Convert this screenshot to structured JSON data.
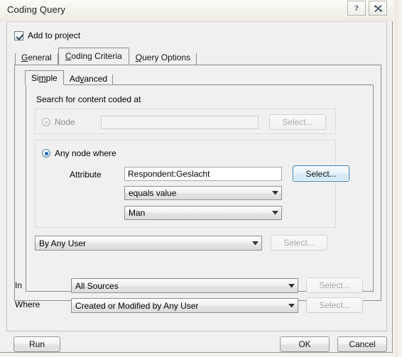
{
  "window": {
    "title": "Coding Query",
    "help_icon": "question-mark-icon",
    "close_icon": "close-x-icon"
  },
  "add_to_project": {
    "label": "Add to project",
    "checked": true
  },
  "tabs": [
    {
      "label": "General",
      "mnemonic": "G",
      "active": false
    },
    {
      "label": "Coding Criteria",
      "mnemonic": "C",
      "active": true
    },
    {
      "label": "Query Options",
      "mnemonic": "Q",
      "active": false
    }
  ],
  "subtabs": [
    {
      "label": "Simple",
      "mnemonic": "m",
      "active": true
    },
    {
      "label": "Advanced",
      "mnemonic": "v",
      "active": false
    }
  ],
  "criteria": {
    "heading": "Search for content coded at",
    "node_option": {
      "label": "Node",
      "selected": false,
      "value": "",
      "select_button": "Select..."
    },
    "any_node_option": {
      "label": "Any node where",
      "selected": true,
      "attribute_label": "Attribute",
      "attribute_value": "Respondent:Geslacht",
      "select_button": "Select...",
      "operator_value": "equals value",
      "operand_value": "Man"
    },
    "user_scope": {
      "value": "By Any User",
      "select_button": "Select..."
    }
  },
  "scope": {
    "in_label": "In",
    "in_value": "All Sources",
    "in_select_button": "Select...",
    "where_label": "Where",
    "where_value": "Created or Modified by Any User",
    "where_select_button": "Select..."
  },
  "footer": {
    "run_label": "Run",
    "ok_label": "OK",
    "cancel_label": "Cancel"
  },
  "colors": {
    "dialog_background": "#f0f0f0",
    "focus_border": "#3c7fb1",
    "radio_dot": "#1e6fb8",
    "disabled_text": "#a8a8a8"
  }
}
